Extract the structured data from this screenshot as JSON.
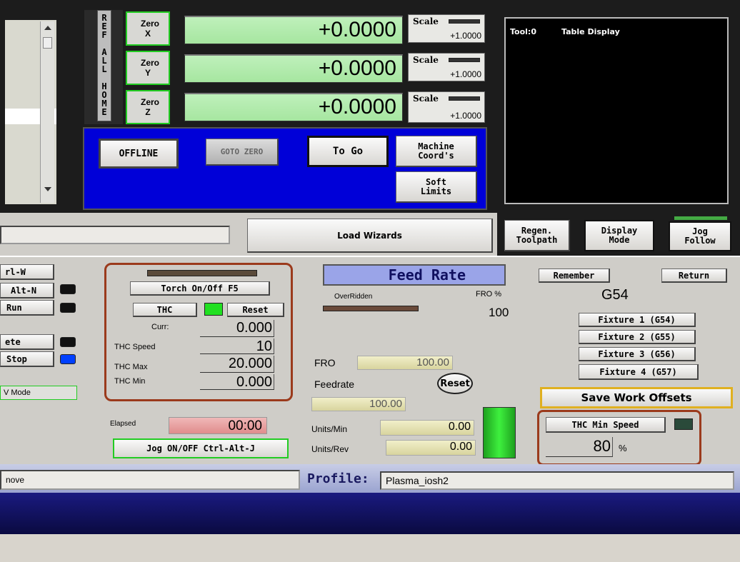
{
  "leftPanel": {
    "items": [
      "rl-W",
      "Alt-N",
      "Run",
      "ete",
      "Stop"
    ],
    "cvMode": "V Mode",
    "statusText": "nove"
  },
  "dro": {
    "refAllHome": "REF ALL HOME",
    "zeroX": "Zero X",
    "zeroY": "Zero Y",
    "zeroZ": "Zero Z",
    "x": "+0.0000",
    "y": "+0.0000",
    "z": "+0.0000",
    "scaleLabel": "Scale",
    "scaleX": "+1.0000",
    "scaleY": "+1.0000",
    "scaleZ": "+1.0000",
    "offline": "OFFLINE",
    "gotoZero": "GOTO ZERO",
    "toGo": "To Go",
    "machineCoords": "Machine Coord's",
    "softLimits": "Soft Limits"
  },
  "toolDisplay": {
    "tool": "Tool:0",
    "title": "Table Display"
  },
  "buttons": {
    "loadWizards": "Load Wizards",
    "regen": "Regen. Toolpath",
    "displayMode": "Display Mode",
    "jogFollow": "Jog Follow"
  },
  "thc": {
    "torch": "Torch On/Off F5",
    "thc": "THC",
    "reset": "Reset",
    "currLabel": "Curr:",
    "curr": "0.000",
    "speedLabel": "THC Speed",
    "speed": "10",
    "maxLabel": "THC Max",
    "max": "20.000",
    "minLabel": "THC Min",
    "min": "0.000",
    "elapsedLabel": "Elapsed",
    "elapsed": "00:00",
    "jog": "Jog ON/OFF Ctrl-Alt-J"
  },
  "feed": {
    "title": "Feed Rate",
    "overridden": "OverRidden",
    "froPctLabel": "FRO %",
    "froPct": "100",
    "froLabel": "FRO",
    "fro": "100.00",
    "feedrateLabel": "Feedrate",
    "reset": "Reset",
    "feedrate": "100.00",
    "unitsMinLabel": "Units/Min",
    "unitsMin": "0.00",
    "unitsRevLabel": "Units/Rev",
    "unitsRev": "0.00"
  },
  "offsets": {
    "remember": "Remember",
    "return": "Return",
    "current": "G54",
    "f1": "Fixture 1 (G54)",
    "f2": "Fixture 2 (G55)",
    "f3": "Fixture 3 (G56)",
    "f4": "Fixture 4 (G57)",
    "save": "Save Work Offsets",
    "thcMinSpeed": "THC Min Speed",
    "minSpeedValue": "80",
    "pct": "%"
  },
  "profile": {
    "label": "Profile:",
    "value": "Plasma_iosh2"
  },
  "colors": {
    "blue": "#0000d8",
    "highlight": "#9b3a1c",
    "green": "#21e021"
  }
}
